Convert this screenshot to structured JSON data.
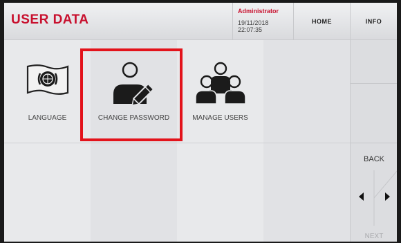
{
  "header": {
    "title": "USER DATA",
    "user_role": "Administrator",
    "date": "19/11/2018",
    "time": "22:07:35",
    "home_label": "HOME",
    "info_label": "INFO"
  },
  "tiles": [
    {
      "label": "LANGUAGE",
      "icon": "language-flag-icon"
    },
    {
      "label": "CHANGE PASSWORD",
      "icon": "user-edit-icon"
    },
    {
      "label": "MANAGE USERS",
      "icon": "users-group-icon"
    }
  ],
  "nav": {
    "back_label": "BACK",
    "next_label": "NEXT"
  },
  "colors": {
    "accent": "#c8102e",
    "highlight": "#e3131b",
    "background": "#e9eaec"
  }
}
